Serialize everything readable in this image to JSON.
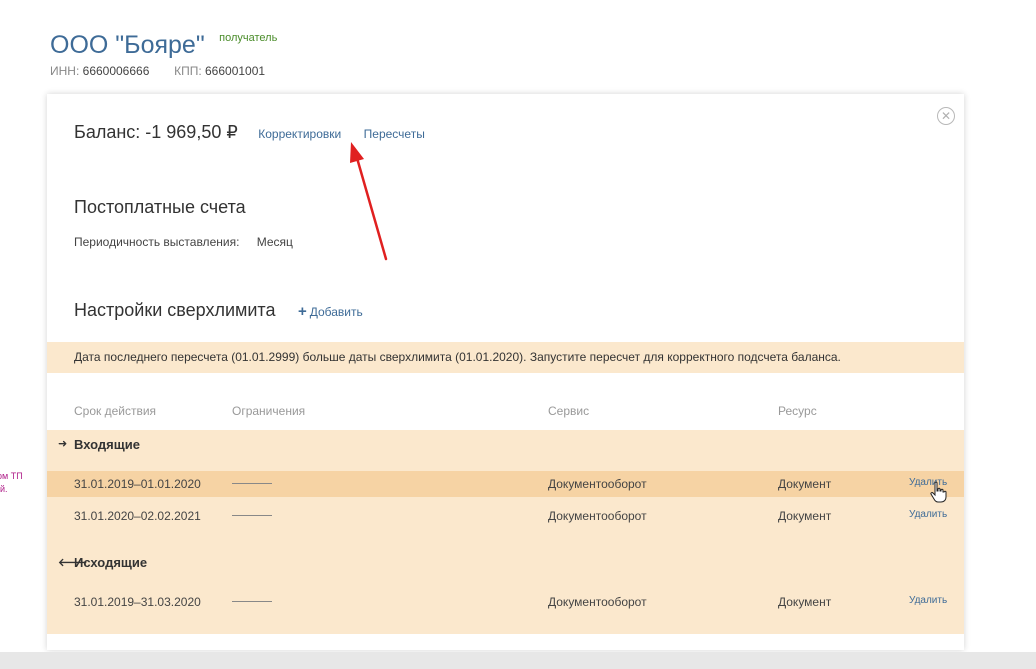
{
  "company": {
    "name": "ООО \"Бояре\"",
    "role_badge": "получатель",
    "inn_label": "ИНН:",
    "inn_value": "6660006666",
    "kpp_label": "КПП:",
    "kpp_value": "666001001"
  },
  "side_note": {
    "line1": "арм ТП",
    "line2": "й."
  },
  "panel": {
    "close_icon": "close-circle-icon",
    "balance_text": "Баланс: -1 969,50 ₽",
    "corrections_link": "Корректировки",
    "recalcs_link": "Пересчеты",
    "postpaid_title": "Постоплатные счета",
    "period_label": "Периодичность выставления:",
    "period_value": "Месяц",
    "overlimit_title": "Настройки сверхлимита",
    "add_label": "Добавить",
    "warning": "Дата последнего пересчета (01.01.2999) больше даты сверхлимита (01.01.2020). Запустите пересчет для корректного подсчета баланса."
  },
  "table": {
    "headers": {
      "period": "Срок действия",
      "limit": "Ограничения",
      "service": "Сервис",
      "resource": "Ресурс"
    },
    "groups": [
      {
        "label": "Входящие",
        "icon": "arrow-right-icon",
        "rows": [
          {
            "period": "31.01.2019–01.01.2020",
            "service": "Документооборот",
            "resource": "Документ",
            "action": "Удалить"
          },
          {
            "period": "31.01.2020–02.02.2021",
            "service": "Документооборот",
            "resource": "Документ",
            "action": "Удалить"
          }
        ]
      },
      {
        "label": "Исходящие",
        "icon": "arrow-left-icon",
        "rows": [
          {
            "period": "31.01.2019–31.03.2020",
            "service": "Документооборот",
            "resource": "Документ",
            "action": "Удалить"
          }
        ]
      }
    ]
  },
  "colors": {
    "link": "#3e6b97",
    "badge": "#4a8c2a",
    "banner_bg": "#fbe8cd",
    "row_hover_bg": "#f6d3a4",
    "annotation_arrow": "#e02020"
  }
}
